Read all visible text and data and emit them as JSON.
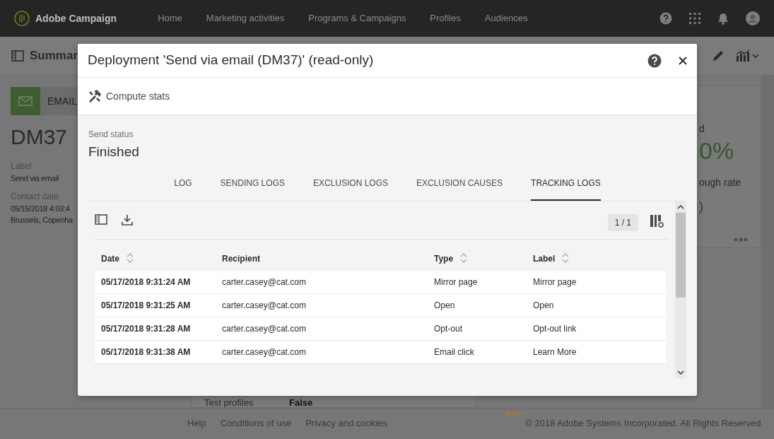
{
  "navbar": {
    "brand": "Adobe Campaign",
    "items": [
      {
        "label": "Home",
        "selected": false
      },
      {
        "label": "Marketing activities",
        "selected": false
      },
      {
        "label": "Programs & Campaigns",
        "selected": false
      },
      {
        "label": "Profiles",
        "selected": false
      },
      {
        "label": "Audiences",
        "selected": false
      }
    ]
  },
  "page_header": {
    "title": "Summar"
  },
  "summary": {
    "channel": "EMAIL",
    "code": "DM37",
    "fields": [
      {
        "label": "Label",
        "values": [
          "Send via email"
        ]
      },
      {
        "label": "Contact date",
        "values": [
          "05/15/2018 4:03:4",
          "Brussels, Copenha"
        ]
      }
    ]
  },
  "details": [
    {
      "label": "Test profiles",
      "value": "False"
    }
  ],
  "stats_card": {
    "items": [
      {
        "kind": "label",
        "text": "d"
      },
      {
        "kind": "value",
        "text": "0%"
      },
      {
        "kind": "label",
        "text": "ough rate"
      },
      {
        "kind": "muted",
        "text": ")"
      }
    ]
  },
  "tag": "Beta",
  "footer": {
    "links": [
      "Help",
      "Conditions of use",
      "Privacy and cookies"
    ],
    "copyright": "© 2018 Adobe Systems Incorporated. All Rights Reserved."
  },
  "dialog": {
    "title": "Deployment 'Send via email (DM37)' (read-only)",
    "action": "Compute stats",
    "send_status_label": "Send status",
    "send_status": "Finished",
    "tabs": [
      {
        "label": "LOG",
        "selected": false
      },
      {
        "label": "SENDING LOGS",
        "selected": false
      },
      {
        "label": "EXCLUSION LOGS",
        "selected": false
      },
      {
        "label": "EXCLUSION CAUSES",
        "selected": false
      },
      {
        "label": "TRACKING LOGS",
        "selected": true
      }
    ],
    "pager": "1 / 1",
    "table": {
      "columns": [
        {
          "label": "Date",
          "sortable": true
        },
        {
          "label": "Recipient",
          "sortable": false
        },
        {
          "label": "Type",
          "sortable": true
        },
        {
          "label": "Label",
          "sortable": true
        }
      ],
      "rows": [
        [
          "05/17/2018 9:31:24 AM",
          "carter.casey@cat.com",
          "Mirror page",
          "Mirror page"
        ],
        [
          "05/17/2018 9:31:25 AM",
          "carter.casey@cat.com",
          "Open",
          "Open"
        ],
        [
          "05/17/2018 9:31:28 AM",
          "carter.casey@cat.com",
          "Opt-out",
          "Opt-out link"
        ],
        [
          "05/17/2018 9:31:38 AM",
          "carter.casey@cat.com",
          "Email click",
          "Learn More"
        ]
      ]
    }
  }
}
